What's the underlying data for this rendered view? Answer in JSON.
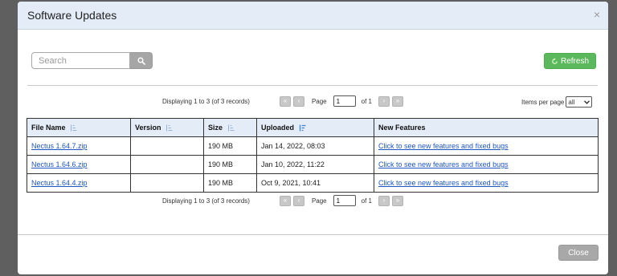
{
  "dialog": {
    "title": "Software Updates",
    "close_glyph": "×"
  },
  "toolbar": {
    "search_placeholder": "Search",
    "search_icon": "search-icon",
    "refresh_label": "Refresh",
    "refresh_icon": "refresh-icon"
  },
  "pager_top": {
    "display_text": "Displaying 1 to 3 (of 3 records)",
    "page_label": "Page",
    "page_value": "1",
    "of_label": "of 1"
  },
  "pager_bottom": {
    "display_text": "Displaying 1 to 3 (of 3 records)",
    "page_label": "Page",
    "page_value": "1",
    "of_label": "of 1"
  },
  "items_per_page": {
    "label": "Items per page",
    "value": "all"
  },
  "table": {
    "columns": [
      "File Name",
      "Version",
      "Size",
      "Uploaded",
      "New Features"
    ],
    "rows": [
      {
        "file_name": "Nectus 1.64.7.zip",
        "version": "",
        "size": "190 MB",
        "uploaded": "Jan 14, 2022, 08:03",
        "features": "Click to see new features and fixed bugs"
      },
      {
        "file_name": "Nectus 1.64.6.zip",
        "version": "",
        "size": "190 MB",
        "uploaded": "Jan 10, 2022, 11:22",
        "features": "Click to see new features and fixed bugs"
      },
      {
        "file_name": "Nectus 1.64.4.zip",
        "version": "",
        "size": "190 MB",
        "uploaded": "Oct 9, 2021, 10:41",
        "features": "Click to see new features and fixed bugs"
      }
    ]
  },
  "footer": {
    "close_label": "Close"
  },
  "colors": {
    "header_bg": "#e4ecf7",
    "refresh_green": "#5cb85c",
    "link_blue": "#1e56c6",
    "active_sort_blue": "#3b7fe0"
  }
}
